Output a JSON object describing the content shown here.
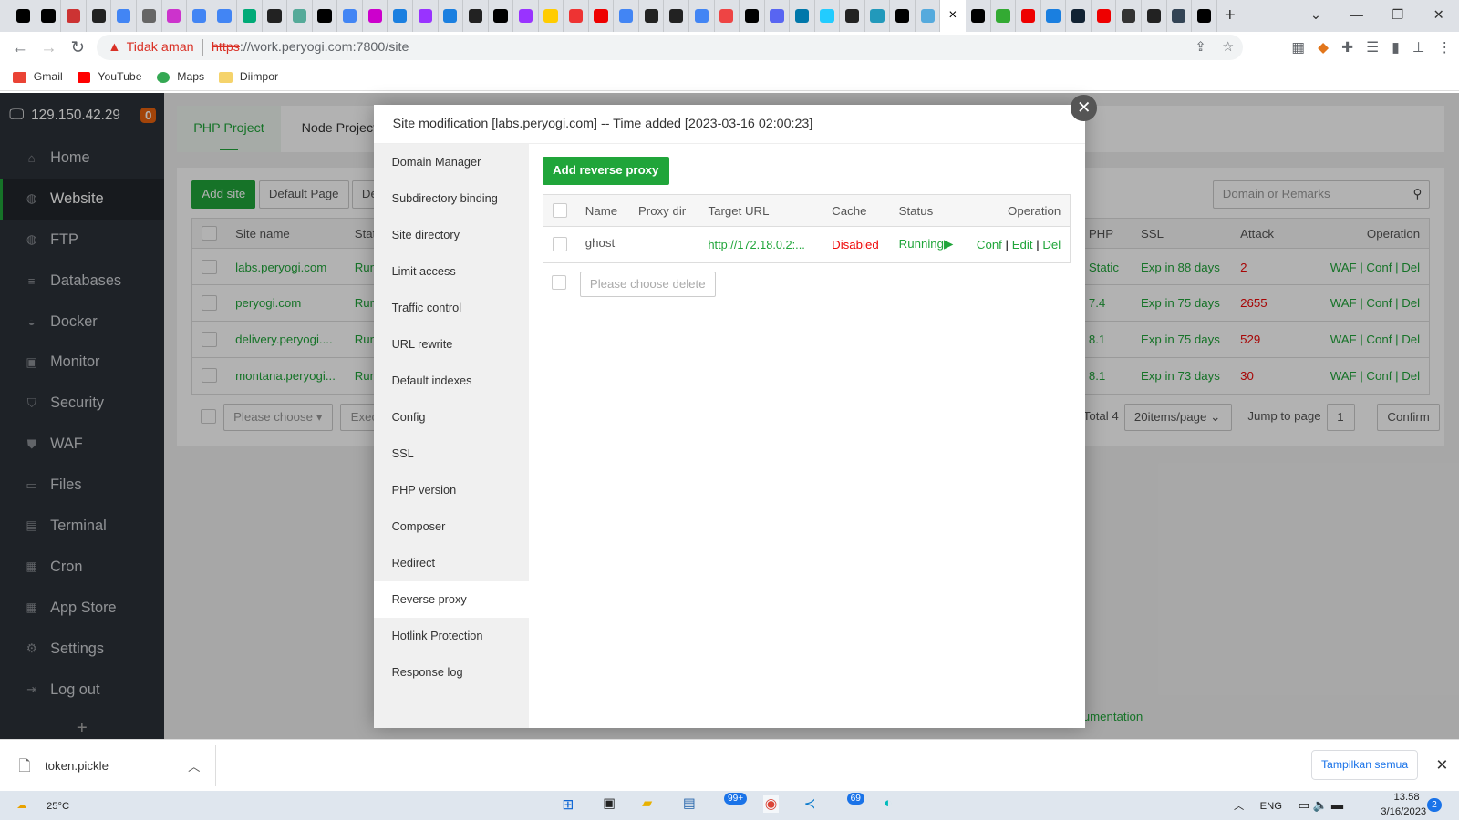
{
  "browser": {
    "favicons": [
      "#000",
      "#000",
      "#c33",
      "#222",
      "#4285f4",
      "#666",
      "#c3c",
      "#4285f4",
      "#4285f4",
      "#0a7",
      "#222",
      "#5a9",
      "#000",
      "#4285f4",
      "#c0c",
      "#1a7fe0",
      "#93f",
      "#1a7fe0",
      "#222",
      "#000",
      "#93f",
      "#fc0",
      "#e33",
      "#e00",
      "#4285f4",
      "#222",
      "#222",
      "#4285f4",
      "#e44",
      "#000",
      "#5865f2",
      "#07a",
      "#2cf",
      "#222",
      "#29b",
      "#000",
      "#5ad"
    ],
    "favicons_right": [
      "#000",
      "#3a3",
      "#e00",
      "#1a7fe0",
      "#123",
      "#e00",
      "#333",
      "#222",
      "#345",
      "#000"
    ],
    "active_tab_close": "×",
    "new_tab": "+",
    "security_warning": "Tidak aman",
    "url_scheme": "https",
    "url_rest": "://work.peryogi.com:7800/site",
    "bookmarks": [
      {
        "label": "Gmail",
        "color": "#ea4335"
      },
      {
        "label": "YouTube",
        "color": "#f00"
      },
      {
        "label": "Maps",
        "color": "#34a853"
      },
      {
        "label": "Diimpor",
        "color": "#f5d36b"
      }
    ]
  },
  "sidebar": {
    "server_ip": "129.150.42.29",
    "badge": "0",
    "items": [
      {
        "label": "Home",
        "icon": "⌂"
      },
      {
        "label": "Website",
        "icon": "◍"
      },
      {
        "label": "FTP",
        "icon": "◍"
      },
      {
        "label": "Databases",
        "icon": "≡"
      },
      {
        "label": "Docker",
        "icon": "◒"
      },
      {
        "label": "Monitor",
        "icon": "▣"
      },
      {
        "label": "Security",
        "icon": "⛉"
      },
      {
        "label": "WAF",
        "icon": "⛊"
      },
      {
        "label": "Files",
        "icon": "▭"
      },
      {
        "label": "Terminal",
        "icon": "▤"
      },
      {
        "label": "Cron",
        "icon": "▦"
      },
      {
        "label": "App Store",
        "icon": "▦"
      },
      {
        "label": "Settings",
        "icon": "⚙"
      },
      {
        "label": "Log out",
        "icon": "⇥"
      }
    ],
    "add": "+"
  },
  "page": {
    "tabs": [
      "PHP Project",
      "Node Project"
    ],
    "add_site": "Add site",
    "default_page": "Default Page",
    "de": "De",
    "search_placeholder": "Domain or Remarks",
    "columns": {
      "site_name": "Site name",
      "status": "Stat",
      "php": "PHP",
      "ssl": "SSL",
      "attack": "Attack",
      "operation": "Operation"
    },
    "rows": [
      {
        "name": "labs.peryogi.com",
        "status": "Run",
        "php": "Static",
        "ssl": "Exp in 88 days",
        "attack": "2"
      },
      {
        "name": "peryogi.com",
        "status": "Run",
        "php": "7.4",
        "ssl": "Exp in 75 days",
        "attack": "2655"
      },
      {
        "name": "delivery.peryogi....",
        "status": "Run",
        "php": "8.1",
        "ssl": "Exp in 75 days",
        "attack": "529"
      },
      {
        "name": "montana.peryogi...",
        "status": "Run",
        "php": "8.1",
        "ssl": "Exp in 73 days",
        "attack": "30"
      }
    ],
    "row_ops": "WAF | Conf | Del",
    "batch_placeholder": "Please choose",
    "exec": "Exec",
    "total": "Total 4",
    "per_page": "20items/page",
    "jump": "Jump to page",
    "page_num": "1",
    "confirm": "Confirm",
    "documentation": "umentation"
  },
  "modal": {
    "title": "Site modification [labs.peryogi.com] -- Time added [2023-03-16 02:00:23]",
    "nav": [
      "Domain Manager",
      "Subdirectory binding",
      "Site directory",
      "Limit access",
      "Traffic control",
      "URL rewrite",
      "Default indexes",
      "Config",
      "SSL",
      "PHP version",
      "Composer",
      "Redirect",
      "Reverse proxy",
      "Hotlink Protection",
      "Response log"
    ],
    "active_nav": "Reverse proxy",
    "add_button": "Add reverse proxy",
    "columns": {
      "name": "Name",
      "proxy_dir": "Proxy dir",
      "target": "Target URL",
      "cache": "Cache",
      "status": "Status",
      "operation": "Operation"
    },
    "rows": [
      {
        "name": "ghost",
        "proxy_dir": "",
        "target": "http://172.18.0.2:...",
        "cache": "Disabled",
        "status": "Running",
        "ops": {
          "conf": "Conf",
          "edit": "Edit",
          "del": "Del"
        }
      }
    ],
    "delete_placeholder": "Please choose delete"
  },
  "downloads": {
    "file": "token.pickle",
    "show_all": "Tampilkan semua"
  },
  "taskbar": {
    "weather": "25°C",
    "chat_badge": "99+",
    "mail_badge": "69",
    "lang": "ENG",
    "time": "13.58",
    "date": "3/16/2023",
    "notif": "2"
  }
}
